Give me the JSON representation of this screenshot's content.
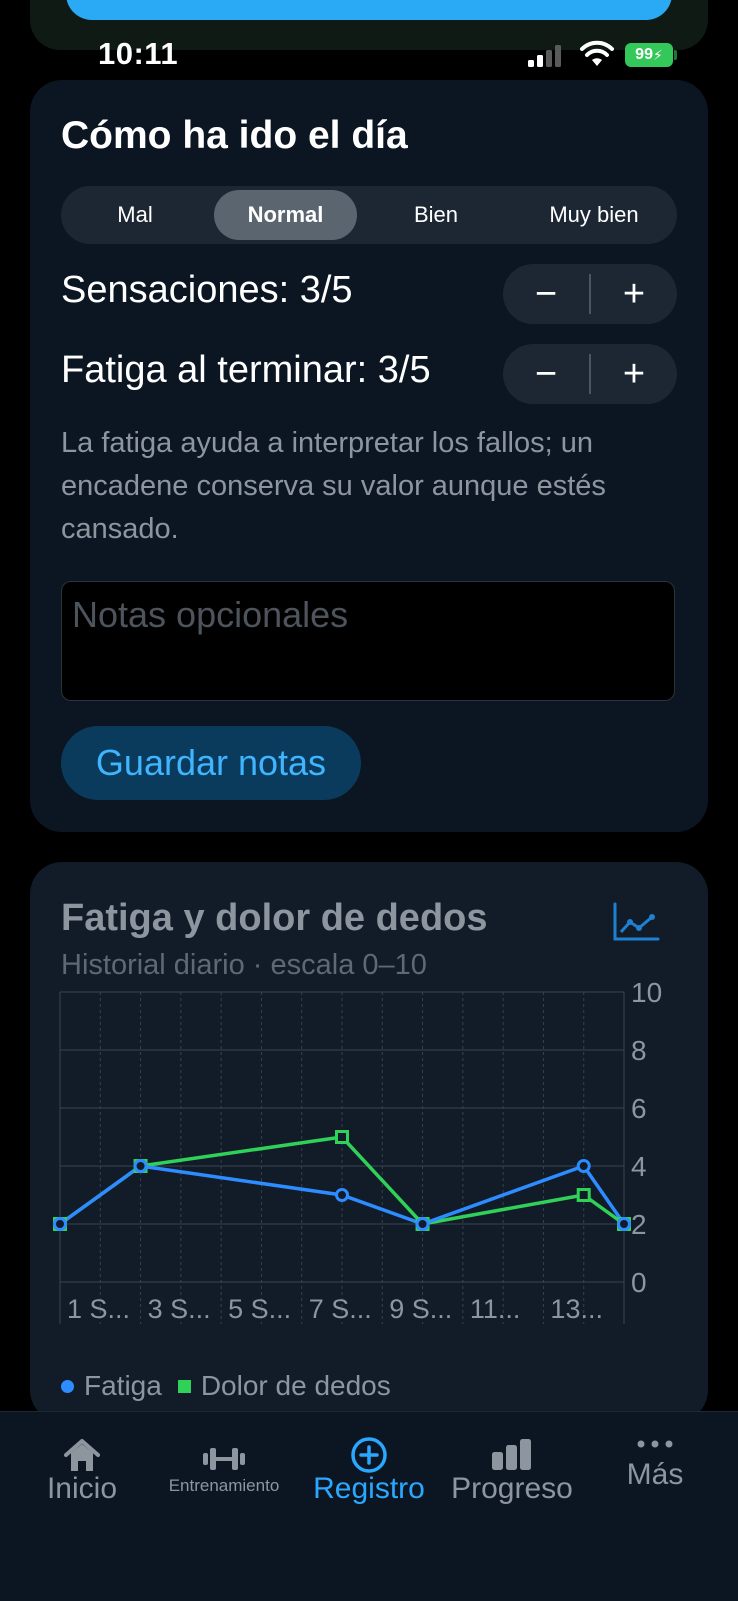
{
  "status_bar": {
    "time": "10:11",
    "battery": "99"
  },
  "day_card": {
    "title": "Cómo ha ido el día",
    "mood_options": [
      "Mal",
      "Normal",
      "Bien",
      "Muy bien"
    ],
    "selected_mood": "Normal",
    "sensations_label": "Sensaciones: 3/5",
    "fatigue_label": "Fatiga al terminar: 3/5",
    "stepper_minus": "−",
    "stepper_plus": "+",
    "help_text": "La fatiga ayuda a interpretar los fallos; un encadene conserva su valor aunque estés cansado.",
    "notes_placeholder": "Notas opcionales",
    "notes_value": "",
    "save_label": "Guardar notas"
  },
  "chart_card": {
    "title": "Fatiga y dolor de dedos",
    "subtitle": "Historial diario · escala 0–10",
    "icon": "line-chart-icon"
  },
  "chart_data": {
    "type": "line",
    "title": "Fatiga y dolor de dedos",
    "subtitle": "Historial diario · escala 0–10",
    "x_ticks": [
      "1 S...",
      "3 S...",
      "5 S...",
      "7 S...",
      "9 S...",
      "11...",
      "13..."
    ],
    "x_range": [
      1,
      15
    ],
    "ylim": [
      0,
      10
    ],
    "y_ticks": [
      0,
      2,
      4,
      6,
      8,
      10
    ],
    "grid": true,
    "legend_position": "bottom-left",
    "series": [
      {
        "name": "Fatiga",
        "color": "#2d8cff",
        "marker": "circle",
        "points": [
          [
            1,
            2
          ],
          [
            3,
            4
          ],
          [
            8,
            3
          ],
          [
            10,
            2
          ],
          [
            14,
            4
          ],
          [
            15,
            2
          ]
        ]
      },
      {
        "name": "Dolor de dedos",
        "color": "#2fd158",
        "marker": "square",
        "points": [
          [
            1,
            2
          ],
          [
            3,
            4
          ],
          [
            8,
            5
          ],
          [
            10,
            2
          ],
          [
            14,
            3
          ],
          [
            15,
            2
          ]
        ]
      }
    ]
  },
  "tab_bar": {
    "items": [
      {
        "label": "Inicio",
        "icon": "home-icon"
      },
      {
        "label": "Entrenamiento",
        "icon": "dumbbell-icon"
      },
      {
        "label": "Registro",
        "icon": "plus-circle-icon"
      },
      {
        "label": "Progreso",
        "icon": "bar-chart-icon"
      },
      {
        "label": "Más",
        "icon": "more-icon"
      }
    ],
    "active": "Registro"
  },
  "colors": {
    "accent": "#2aa7ff",
    "fatigue": "#2d8cff",
    "finger_pain": "#2fd158",
    "card_bg": "#0c1622",
    "battery": "#34c759"
  }
}
